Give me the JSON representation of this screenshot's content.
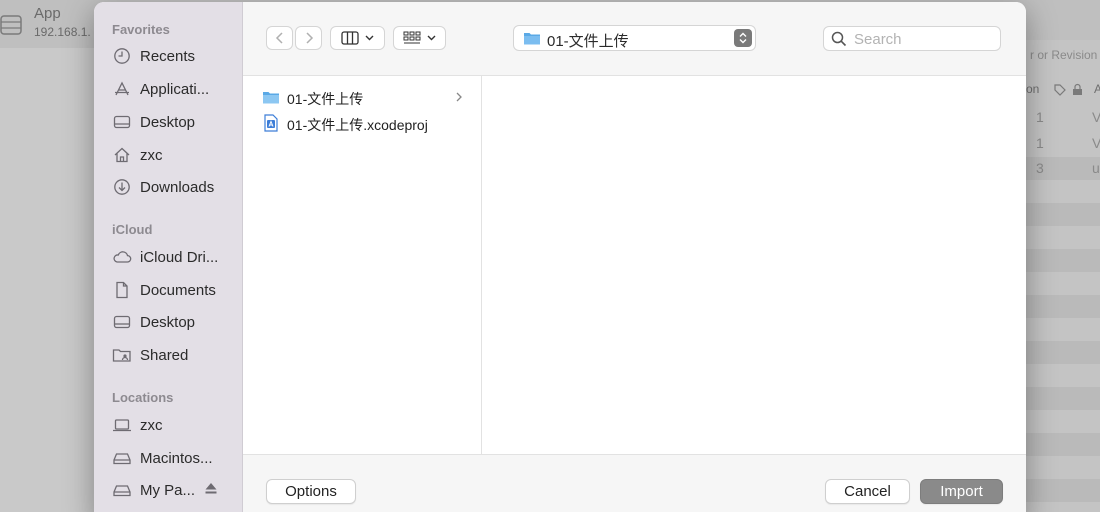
{
  "background_app": {
    "name": "App",
    "ip": "192.168.1.",
    "hint": "r or Revision",
    "header_text": "on",
    "header_col": "A",
    "rows": [
      {
        "n": "1",
        "v": "V"
      },
      {
        "n": "1",
        "v": "V"
      },
      {
        "n": "3",
        "v": "u"
      }
    ]
  },
  "sidebar": {
    "sections": [
      {
        "title": "Favorites",
        "items": [
          {
            "label": "Recents",
            "icon": "clock-icon"
          },
          {
            "label": "Applicati...",
            "icon": "applications-icon"
          },
          {
            "label": "Desktop",
            "icon": "desktop-icon"
          },
          {
            "label": "zxc",
            "icon": "home-icon"
          },
          {
            "label": "Downloads",
            "icon": "download-icon"
          }
        ]
      },
      {
        "title": "iCloud",
        "items": [
          {
            "label": "iCloud Dri...",
            "icon": "cloud-icon"
          },
          {
            "label": "Documents",
            "icon": "document-icon"
          },
          {
            "label": "Desktop",
            "icon": "desktop-icon"
          },
          {
            "label": "Shared",
            "icon": "shared-folder-icon"
          }
        ]
      },
      {
        "title": "Locations",
        "items": [
          {
            "label": "zxc",
            "icon": "laptop-icon"
          },
          {
            "label": "Macintos...",
            "icon": "drive-icon"
          },
          {
            "label": "My Pa...",
            "icon": "drive-icon"
          }
        ]
      }
    ]
  },
  "toolbar": {
    "path": "01-文件上传",
    "search_placeholder": "Search"
  },
  "files": [
    {
      "name": "01-文件上传",
      "type": "folder"
    },
    {
      "name": "01-文件上传.xcodeproj",
      "type": "xcodeproj"
    }
  ],
  "footer": {
    "options_label": "Options",
    "cancel_label": "Cancel",
    "import_label": "Import"
  },
  "colors": {
    "sidebar_bg": "#e3dfe6",
    "folder_blue": "#5aa9e6",
    "primary_disabled": "#8a8a8a"
  }
}
